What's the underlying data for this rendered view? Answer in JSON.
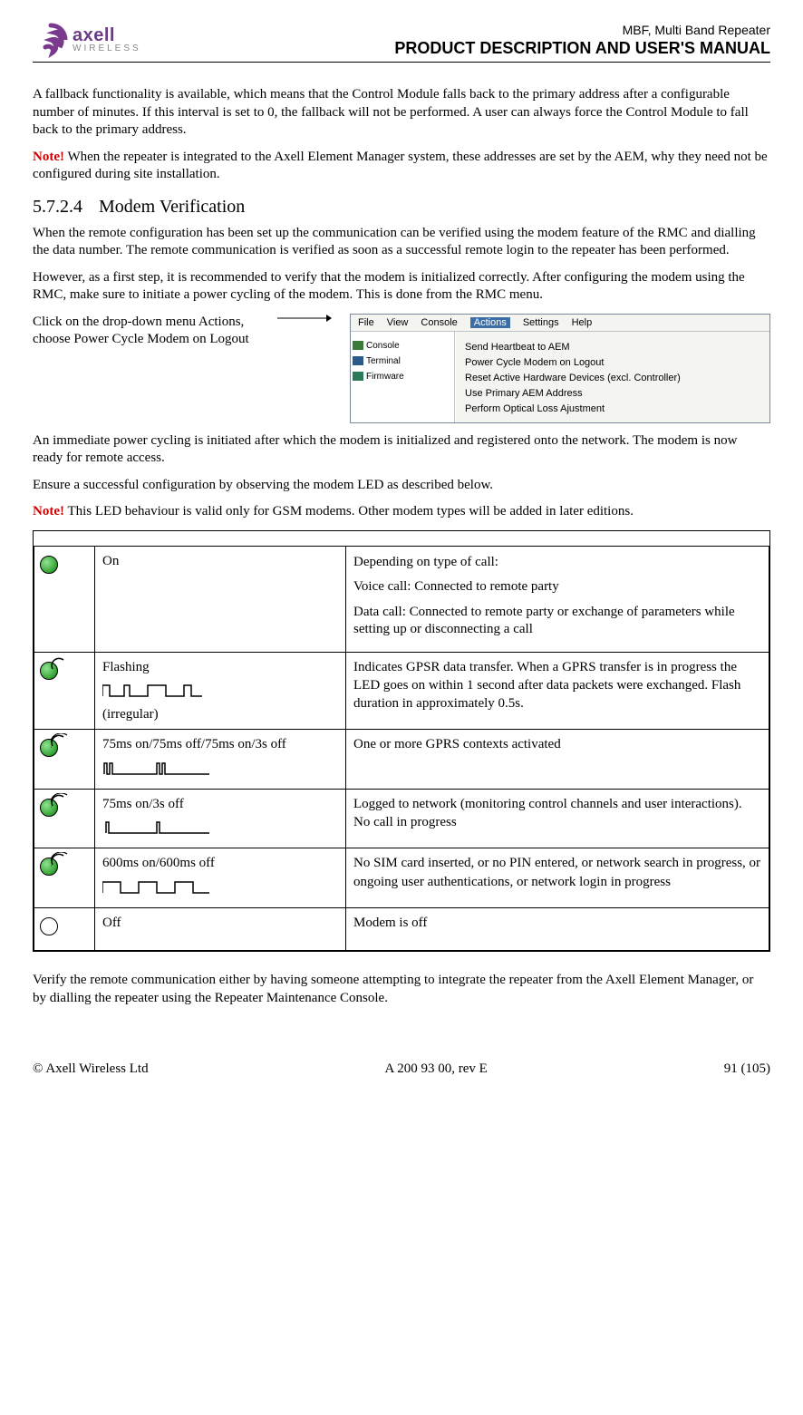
{
  "header": {
    "logo_top": "axell",
    "logo_bottom": "WIRELESS",
    "subtitle": "MBF, Multi Band Repeater",
    "title": "PRODUCT DESCRIPTION AND USER'S MANUAL"
  },
  "body": {
    "p1": "A fallback functionality is available, which means that the Control Module falls back to the primary address after a configurable number of minutes. If this interval is set to 0, the fallback will not be performed. A user can always force the Control Module to fall back to the primary address.",
    "note1_label": "Note!",
    "note1": " When the repeater is integrated to the Axell Element Manager system, these addresses are set by the AEM, why they need not be configured during site installation.",
    "section_num": "5.7.2.4",
    "section_title": "Modem Verification",
    "p2": "When the remote configuration has been set up the communication can be verified using the modem feature of the RMC and dialling the data number. The remote communication is verified as soon as a successful remote login to the repeater has been performed.",
    "p3": "However, as a first step, it is recommended to verify that the modem is initialized correctly. After configuring the modem using the RMC, make sure to initiate a power cycling of the modem. This is done from the RMC menu.",
    "rmc_caption": "Click on the drop-down menu Actions, choose Power Cycle Modem on Logout",
    "p4": "An immediate power cycling is initiated after which the modem is initialized and registered onto the network. The modem is now ready for remote access.",
    "p5": "Ensure a successful configuration by observing the modem LED as described below.",
    "note2_label": "Note!",
    "note2": " This LED behaviour is valid only for GSM modems. Other modem types will be added in later editions.",
    "p6": "Verify the remote communication either by having someone attempting to integrate the repeater from the Axell Element Manager, or by dialling the repeater using the Repeater Maintenance Console."
  },
  "rmc": {
    "menu": [
      "File",
      "View",
      "Console",
      "Actions",
      "Settings",
      "Help"
    ],
    "tree": [
      "Console",
      "Terminal",
      "Firmware"
    ],
    "dropdown": [
      "Send Heartbeat to AEM",
      "Power Cycle Modem on Logout",
      "Reset Active Hardware Devices (excl. Controller)",
      "Use Primary AEM Address",
      "Perform Optical Loss Ajustment"
    ]
  },
  "led_table": [
    {
      "icon": "on",
      "state": "On",
      "desc_lines": [
        "Depending on type of call:",
        "Voice call: Connected to remote party",
        "Data call: Connected to remote party or exchange of parameters while setting up or disconnecting a call"
      ]
    },
    {
      "icon": "flash",
      "state": "Flashing",
      "state_extra": "(irregular)",
      "wave": "irregular",
      "desc_lines": [
        "Indicates GPSR data transfer. When a GPRS transfer is in progress the LED goes on within 1 second after data packets were exchanged. Flash duration in approximately 0.5s."
      ]
    },
    {
      "icon": "flash",
      "state": "75ms on/75ms off/75ms on/3s off",
      "wave": "double",
      "desc_lines": [
        "One or more GPRS contexts activated"
      ]
    },
    {
      "icon": "flash",
      "state": "75ms on/3s off",
      "wave": "single",
      "desc_lines": [
        "Logged to network (monitoring control channels and user interactions). No call in progress"
      ]
    },
    {
      "icon": "flash",
      "state": "600ms on/600ms off",
      "wave": "square",
      "desc_lines": [
        "No SIM card inserted, or no PIN entered, or network search in progress, or ongoing user authentications, or network login in progress"
      ]
    },
    {
      "icon": "off",
      "state": "Off",
      "desc_lines": [
        "Modem is off"
      ]
    }
  ],
  "footer": {
    "left": "© Axell Wireless Ltd",
    "center": "A 200 93 00, rev E",
    "right": "91 (105)"
  }
}
